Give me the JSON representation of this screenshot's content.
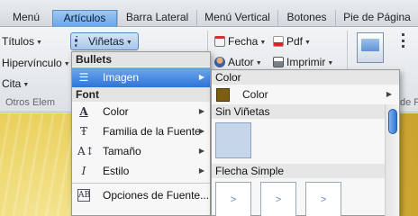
{
  "tabs": [
    {
      "label": "Menú"
    },
    {
      "label": "Artículos"
    },
    {
      "label": "Barra Lateral"
    },
    {
      "label": "Menú Vertical"
    },
    {
      "label": "Botones"
    },
    {
      "label": "Pie de Página"
    }
  ],
  "ribbon": {
    "titulos": "Títulos",
    "hipervinculo": "Hipervínculo",
    "cita": "Cita",
    "vinetas": "Viñetas",
    "fecha": "Fecha",
    "pdf": "Pdf",
    "autor": "Autor",
    "imprimir": "Imprimir",
    "group_left": "Otros Elem",
    "group_right": "de Pá"
  },
  "menu": {
    "bullets_header": "Bullets",
    "imagen": "Imagen",
    "font_header": "Font",
    "color": "Color",
    "familia": "Familia de la Fuente",
    "tamano": "Tamaño",
    "estilo": "Estilo",
    "opciones": "Opciones de Fuente..."
  },
  "submenu": {
    "color_header": "Color",
    "color_item": "Color",
    "sin_vinetas": "Sin Viñetas",
    "flecha_simple": "Flecha Simple",
    "arrow_glyph": ">",
    "swatch_color": "#7d5f14"
  },
  "colors": {
    "accent": "#2f74d6",
    "active_tab": "#6aa5e6"
  }
}
